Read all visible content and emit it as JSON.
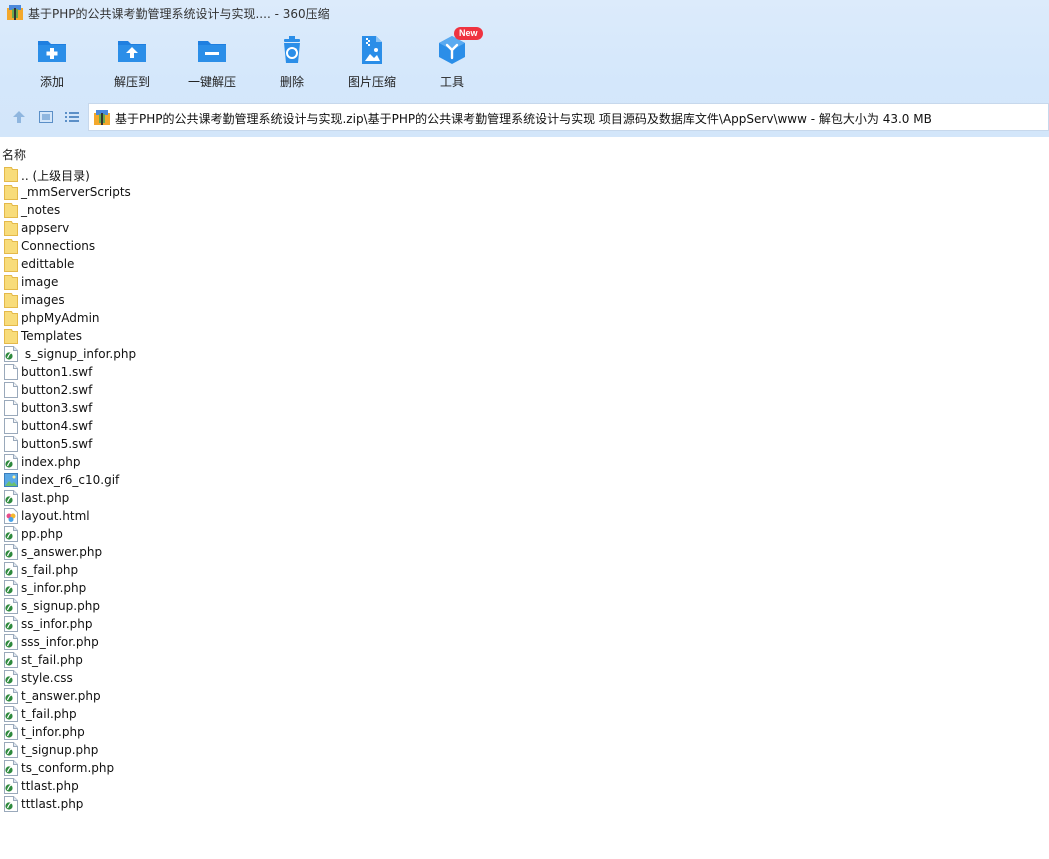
{
  "window": {
    "title": "基于PHP的公共课考勤管理系统设计与实现.... - 360压缩"
  },
  "toolbar": {
    "add": "添加",
    "extract_to": "解压到",
    "one_click_extract": "一键解压",
    "delete": "删除",
    "image_compress": "图片压缩",
    "tools": "工具",
    "new_badge": "New"
  },
  "address": {
    "path": "基于PHP的公共课考勤管理系统设计与实现.zip\\基于PHP的公共课考勤管理系统设计与实现 项目源码及数据库文件\\AppServ\\www - 解包大小为 43.0 MB"
  },
  "list": {
    "column_name": "名称",
    "items": [
      {
        "name": ".. (上级目录)",
        "type": "folder"
      },
      {
        "name": "_mmServerScripts",
        "type": "folder"
      },
      {
        "name": "_notes",
        "type": "folder"
      },
      {
        "name": "appserv",
        "type": "folder"
      },
      {
        "name": "Connections",
        "type": "folder"
      },
      {
        "name": "edittable",
        "type": "folder"
      },
      {
        "name": "image",
        "type": "folder"
      },
      {
        "name": "images",
        "type": "folder"
      },
      {
        "name": "phpMyAdmin",
        "type": "folder"
      },
      {
        "name": "Templates",
        "type": "folder"
      },
      {
        "name": " s_signup_infor.php",
        "type": "php"
      },
      {
        "name": "button1.swf",
        "type": "blank"
      },
      {
        "name": "button2.swf",
        "type": "blank"
      },
      {
        "name": "button3.swf",
        "type": "blank"
      },
      {
        "name": "button4.swf",
        "type": "blank"
      },
      {
        "name": "button5.swf",
        "type": "blank"
      },
      {
        "name": "index.php",
        "type": "php"
      },
      {
        "name": "index_r6_c10.gif",
        "type": "image"
      },
      {
        "name": "last.php",
        "type": "php"
      },
      {
        "name": "layout.html",
        "type": "html"
      },
      {
        "name": "pp.php",
        "type": "php"
      },
      {
        "name": "s_answer.php",
        "type": "php"
      },
      {
        "name": "s_fail.php",
        "type": "php"
      },
      {
        "name": "s_infor.php",
        "type": "php"
      },
      {
        "name": "s_signup.php",
        "type": "php"
      },
      {
        "name": "ss_infor.php",
        "type": "php"
      },
      {
        "name": "sss_infor.php",
        "type": "php"
      },
      {
        "name": "st_fail.php",
        "type": "php"
      },
      {
        "name": "style.css",
        "type": "php"
      },
      {
        "name": "t_answer.php",
        "type": "php"
      },
      {
        "name": "t_fail.php",
        "type": "php"
      },
      {
        "name": "t_infor.php",
        "type": "php"
      },
      {
        "name": "t_signup.php",
        "type": "php"
      },
      {
        "name": "ts_conform.php",
        "type": "php"
      },
      {
        "name": "ttlast.php",
        "type": "php"
      },
      {
        "name": "tttlast.php",
        "type": "php"
      }
    ]
  },
  "colors": {
    "accent": "#2b8ee8",
    "toolbar_bg": "#d6e8fb",
    "folder": "#f8dc7a",
    "badge": "#ef3340"
  }
}
